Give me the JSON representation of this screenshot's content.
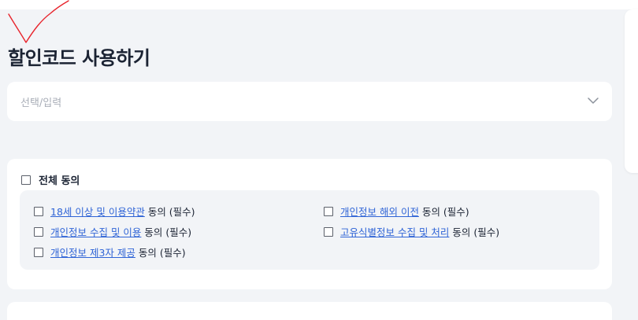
{
  "page": {
    "title": "할인코드 사용하기"
  },
  "discount_select": {
    "placeholder": "선택/입력"
  },
  "consent": {
    "all_label": "전체 동의",
    "items": [
      {
        "link_text": "18세 이상 및 이용약관",
        "suffix": "동의 (필수)",
        "checked": false
      },
      {
        "link_text": "개인정보 해외 이전",
        "suffix": "동의 (필수)",
        "checked": false
      },
      {
        "link_text": "개인정보 수집 및 이용",
        "suffix": "동의 (필수)",
        "checked": false
      },
      {
        "link_text": "고유식별정보 수집 및 처리",
        "suffix": "동의 (필수)",
        "checked": false
      },
      {
        "link_text": "개인정보 제3자 제공",
        "suffix": "동의 (필수)",
        "checked": false
      }
    ]
  },
  "icons": {
    "select_chevron": "chevron-down-icon",
    "annotation": "red-check-mark"
  },
  "colors": {
    "page_background": "#f2f4f7",
    "card_background": "#ffffff",
    "link": "#2f64d6",
    "annotation": "#e8242c"
  }
}
